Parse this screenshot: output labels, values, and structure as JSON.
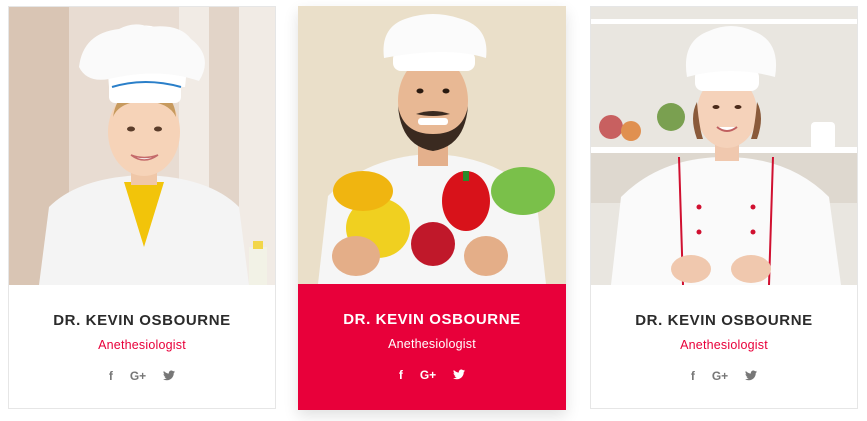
{
  "team": [
    {
      "name": "DR. KEVIN OSBOURNE",
      "role": "Anethesiologist",
      "social": {
        "facebook": "f",
        "google_plus": "G+",
        "twitter": "twitter-icon"
      }
    },
    {
      "name": "DR. KEVIN OSBOURNE",
      "role": "Anethesiologist",
      "social": {
        "facebook": "f",
        "google_plus": "G+",
        "twitter": "twitter-icon"
      }
    },
    {
      "name": "DR. KEVIN OSBOURNE",
      "role": "Anethesiologist",
      "social": {
        "facebook": "f",
        "google_plus": "G+",
        "twitter": "twitter-icon"
      }
    }
  ],
  "colors": {
    "accent": "#e8003a",
    "name_text": "#2b2b2b",
    "icon_grey": "#777777"
  }
}
